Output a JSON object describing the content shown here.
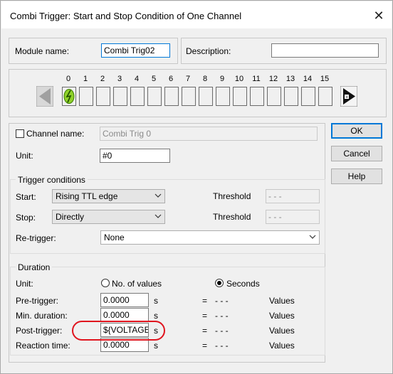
{
  "window": {
    "title": "Combi Trigger: Start and Stop Condition of One Channel",
    "close_glyph": "✕"
  },
  "header": {
    "module_name_label": "Module name:",
    "module_name_value": "Combi Trig02",
    "description_label": "Description:",
    "description_value": ""
  },
  "channels": {
    "numbers": [
      "0",
      "1",
      "2",
      "3",
      "4",
      "5",
      "6",
      "7",
      "8",
      "9",
      "10",
      "11",
      "12",
      "13",
      "14",
      "15"
    ]
  },
  "buttons": {
    "ok": "OK",
    "cancel": "Cancel",
    "help": "Help"
  },
  "channel_panel": {
    "channel_name_label": "Channel name:",
    "channel_name_value": "Combi Trig 0",
    "unit_label": "Unit:",
    "unit_value": "#0"
  },
  "trigger_conditions": {
    "title": "Trigger conditions",
    "start_label": "Start:",
    "start_value": "Rising TTL edge",
    "stop_label": "Stop:",
    "stop_value": "Directly",
    "threshold_label_1": "Threshold",
    "threshold_value_1": "- - -",
    "threshold_label_2": "Threshold",
    "threshold_value_2": "- - -",
    "retrigger_label": "Re-trigger:",
    "retrigger_value": "None"
  },
  "duration": {
    "title": "Duration",
    "unit_label": "Unit:",
    "option_values": "No. of values",
    "option_seconds": "Seconds",
    "rows": [
      {
        "label": "Pre-trigger:",
        "value": "0.0000",
        "unit": "s",
        "eq": "=",
        "dashes": "- - -",
        "values": "Values"
      },
      {
        "label": "Min. duration:",
        "value": "0.0000",
        "unit": "s",
        "eq": "=",
        "dashes": "- - -",
        "values": "Values"
      },
      {
        "label": "Post-trigger:",
        "value": "${VOLTAGE_",
        "unit": "s",
        "eq": "=",
        "dashes": "- - -",
        "values": "Values"
      },
      {
        "label": "Reaction time:",
        "value": "0.0000",
        "unit": "s",
        "eq": "=",
        "dashes": "- - -",
        "values": "Values"
      }
    ]
  }
}
